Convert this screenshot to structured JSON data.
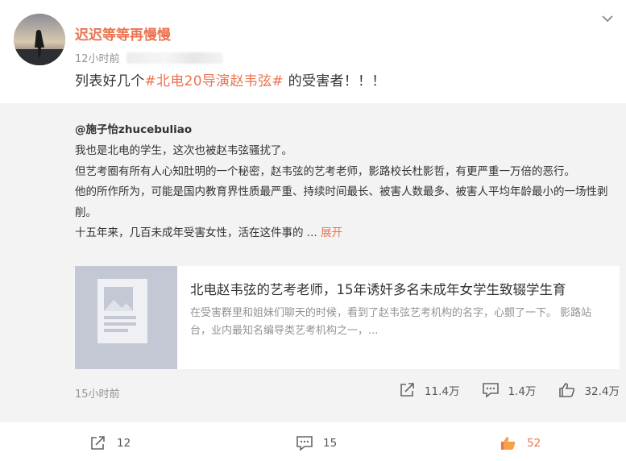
{
  "post": {
    "username": "迟迟等等再慢慢",
    "time": "12小时前",
    "text_before": "列表好几个",
    "hashtag": "#北电20导演赵韦弦#",
    "text_after": " 的受害者！！！"
  },
  "repost": {
    "author": "@施子怡zhucebuliao",
    "paragraphs": [
      "我也是北电的学生，这次也被赵韦弦骚扰了。",
      "但艺考圈有所有人心知肚明的一个秘密，赵韦弦的艺考老师，影路校长杜影哲，有更严重一万倍的恶行。",
      "他的所作所为，可能是国内教育界性质最严重、持续时间最长、被害人数最多、被害人平均年龄最小的一场性剥削。"
    ],
    "last_line": "十五年来，几百未成年受害女性，活在这件事的 ...",
    "expand_label": "展开",
    "article": {
      "title": "北电赵韦弦的艺考老师，15年诱奸多名未成年女学生致辍学生育",
      "summary": "在受害群里和姐妹们聊天的时候，看到了赵韦弦艺考机构的名字，心颤了一下。 影路站台，业内最知名编导类艺考机构之一，..."
    },
    "time": "15小时前",
    "share_count": "11.4万",
    "comment_count": "1.4万",
    "like_count": "32.4万"
  },
  "footer": {
    "share_count": "12",
    "comment_count": "15",
    "like_count": "52"
  },
  "colors": {
    "accent": "#eb7350",
    "repost_bg": "#f3f3f3",
    "muted": "#939393"
  },
  "icons": [
    "chevron-down-icon",
    "share-icon",
    "comment-icon",
    "like-icon",
    "article-placeholder-icon"
  ]
}
